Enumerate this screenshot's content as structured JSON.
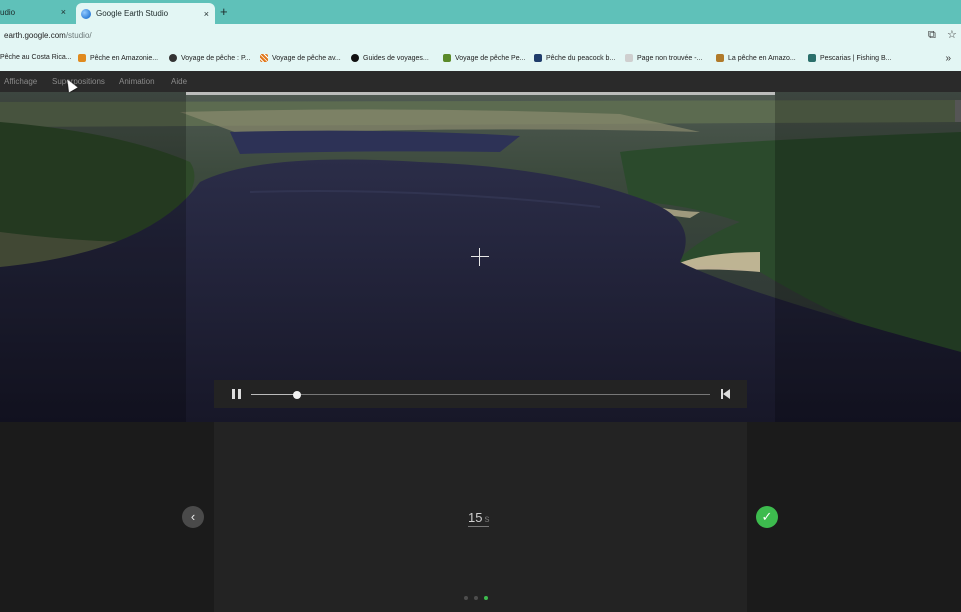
{
  "browser": {
    "tabs": [
      {
        "title": "udio",
        "active": false
      },
      {
        "title": "Google Earth Studio",
        "active": true
      }
    ],
    "new_tab": "+",
    "close_glyph": "×",
    "url": {
      "host": "earth.google.com",
      "path": "/studio/"
    },
    "address_icons": [
      "install-icon",
      "star-icon"
    ],
    "bookmarks": [
      {
        "label": "Pêche au Costa Rica...",
        "icon": "none"
      },
      {
        "label": "Pêche en Amazonie...",
        "icon": "fish-icon"
      },
      {
        "label": "Voyage de pêche : P...",
        "icon": "globe-icon"
      },
      {
        "label": "Voyage de pêche av...",
        "icon": "stripe-icon"
      },
      {
        "label": "Guides de voyages...",
        "icon": "tp-icon"
      },
      {
        "label": "Voyage de pêche Pe...",
        "icon": "fish-icon"
      },
      {
        "label": "Pêche du peacock b...",
        "icon": "square-icon"
      },
      {
        "label": "Page non trouvée -...",
        "icon": "dots-icon"
      },
      {
        "label": "La pêche en Amazo...",
        "icon": "figure-icon"
      },
      {
        "label": "Pescarias | Fishing B...",
        "icon": "flag-icon"
      }
    ],
    "more_bookmarks": "»"
  },
  "app_menu": {
    "items": [
      "Affichage",
      "Superpositions",
      "Animation",
      "Aide"
    ]
  },
  "playback": {
    "state": "playing",
    "progress": 0.1
  },
  "panel": {
    "duration_value": "15",
    "duration_unit": "s",
    "back_glyph": "‹",
    "confirm_glyph": "✓",
    "steps": 3,
    "active_step": 3
  },
  "colors": {
    "tabstrip": "#5fc1b9",
    "toolbar": "#e3f6f4",
    "confirm": "#3dbb4e"
  }
}
